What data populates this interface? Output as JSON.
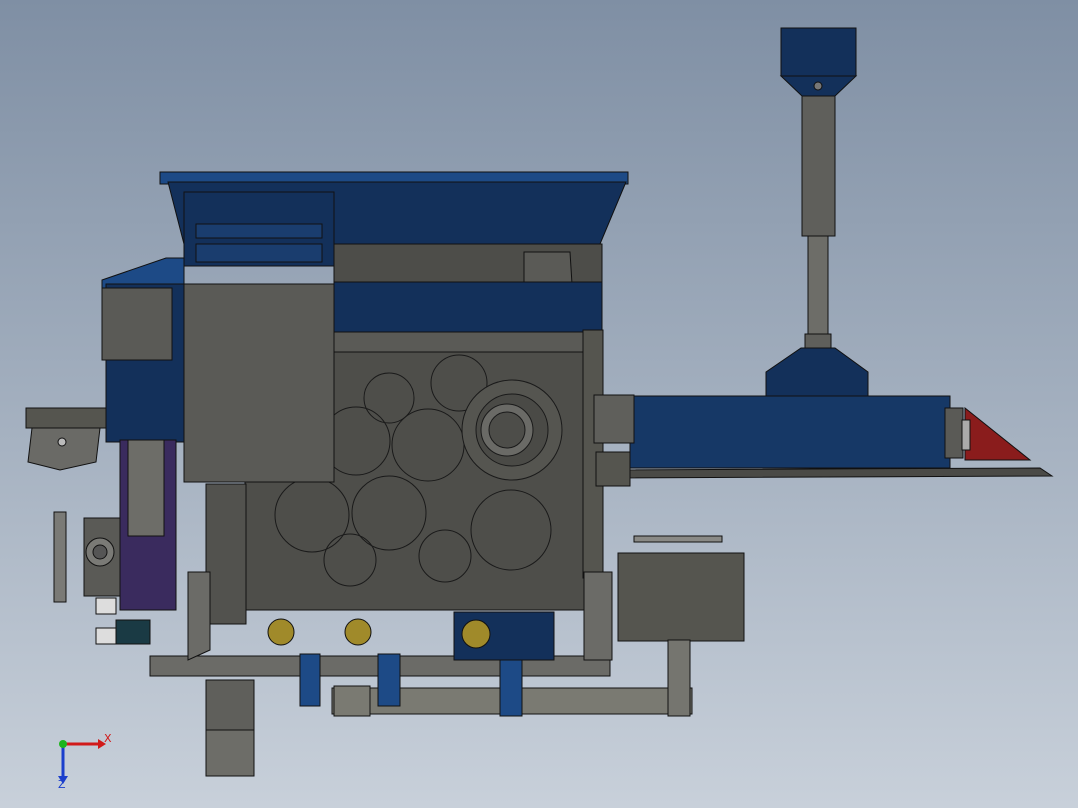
{
  "viewport": {
    "background_top": "#7f8fa4",
    "background_bottom": "#c8d0da"
  },
  "model": {
    "colors": {
      "body_blue": "#13305a",
      "body_blue_light": "#1d4a86",
      "frame_gray": "#5a5a56",
      "frame_gray_dark": "#474743",
      "panel_gray": "#6d6d68",
      "outline": "#111111",
      "accent_red": "#8a1c1c",
      "accent_purple": "#3a2b5e",
      "accent_yellow": "#a08a2a"
    }
  },
  "triad": {
    "x_label": "X",
    "z_label": "Z",
    "x_color": "#d11a1a",
    "y_color": "#1db51d",
    "z_color": "#1b3fcc"
  }
}
